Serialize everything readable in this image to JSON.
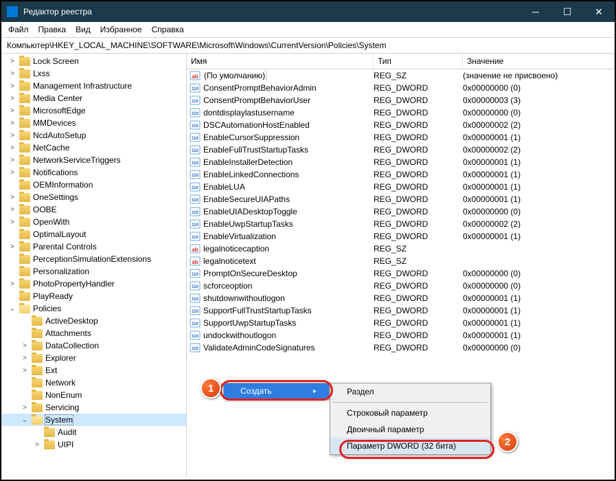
{
  "window": {
    "title": "Редактор реестра"
  },
  "menu": [
    "Файл",
    "Правка",
    "Вид",
    "Избранное",
    "Справка"
  ],
  "address": "Компьютер\\HKEY_LOCAL_MACHINE\\SOFTWARE\\Microsoft\\Windows\\CurrentVersion\\Policies\\System",
  "columns": {
    "name": "Имя",
    "type": "Тип",
    "value": "Значение"
  },
  "tree": [
    {
      "l": "Lock Screen",
      "d": 1,
      "e": ">"
    },
    {
      "l": "Lxss",
      "d": 1,
      "e": ">"
    },
    {
      "l": "Management Infrastructure",
      "d": 1,
      "e": ">"
    },
    {
      "l": "Media Center",
      "d": 1,
      "e": ">"
    },
    {
      "l": "MicrosoftEdge",
      "d": 1,
      "e": ">"
    },
    {
      "l": "MMDevices",
      "d": 1,
      "e": ">"
    },
    {
      "l": "NcdAutoSetup",
      "d": 1,
      "e": ">"
    },
    {
      "l": "NetCache",
      "d": 1,
      "e": ">"
    },
    {
      "l": "NetworkServiceTriggers",
      "d": 1,
      "e": ">"
    },
    {
      "l": "Notifications",
      "d": 1,
      "e": ">"
    },
    {
      "l": "OEMInformation",
      "d": 1,
      "e": ""
    },
    {
      "l": "OneSettings",
      "d": 1,
      "e": ">"
    },
    {
      "l": "OOBE",
      "d": 1,
      "e": ">"
    },
    {
      "l": "OpenWith",
      "d": 1,
      "e": ">"
    },
    {
      "l": "OptimalLayout",
      "d": 1,
      "e": ""
    },
    {
      "l": "Parental Controls",
      "d": 1,
      "e": ">"
    },
    {
      "l": "PerceptionSimulationExtensions",
      "d": 1,
      "e": ""
    },
    {
      "l": "Personalization",
      "d": 1,
      "e": ""
    },
    {
      "l": "PhotoPropertyHandler",
      "d": 1,
      "e": ">"
    },
    {
      "l": "PlayReady",
      "d": 1,
      "e": ""
    },
    {
      "l": "Policies",
      "d": 1,
      "e": "v",
      "open": true
    },
    {
      "l": "ActiveDesktop",
      "d": 2,
      "e": ""
    },
    {
      "l": "Attachments",
      "d": 2,
      "e": ""
    },
    {
      "l": "DataCollection",
      "d": 2,
      "e": ">"
    },
    {
      "l": "Explorer",
      "d": 2,
      "e": ">"
    },
    {
      "l": "Ext",
      "d": 2,
      "e": ">"
    },
    {
      "l": "Network",
      "d": 2,
      "e": ""
    },
    {
      "l": "NonEnum",
      "d": 2,
      "e": ""
    },
    {
      "l": "Servicing",
      "d": 2,
      "e": ">"
    },
    {
      "l": "System",
      "d": 2,
      "e": "v",
      "open": true,
      "sel": true
    },
    {
      "l": "Audit",
      "d": 3,
      "e": ""
    },
    {
      "l": "UIPI",
      "d": 3,
      "e": ">"
    }
  ],
  "values": [
    {
      "n": "(По умолчанию)",
      "t": "REG_SZ",
      "v": "(значение не присвоено)",
      "i": "str",
      "def": true
    },
    {
      "n": "ConsentPromptBehaviorAdmin",
      "t": "REG_DWORD",
      "v": "0x00000000 (0)",
      "i": "bin"
    },
    {
      "n": "ConsentPromptBehaviorUser",
      "t": "REG_DWORD",
      "v": "0x00000003 (3)",
      "i": "bin"
    },
    {
      "n": "dontdisplaylastusername",
      "t": "REG_DWORD",
      "v": "0x00000000 (0)",
      "i": "bin"
    },
    {
      "n": "DSCAutomationHostEnabled",
      "t": "REG_DWORD",
      "v": "0x00000002 (2)",
      "i": "bin"
    },
    {
      "n": "EnableCursorSuppression",
      "t": "REG_DWORD",
      "v": "0x00000001 (1)",
      "i": "bin"
    },
    {
      "n": "EnableFullTrustStartupTasks",
      "t": "REG_DWORD",
      "v": "0x00000002 (2)",
      "i": "bin"
    },
    {
      "n": "EnableInstallerDetection",
      "t": "REG_DWORD",
      "v": "0x00000001 (1)",
      "i": "bin"
    },
    {
      "n": "EnableLinkedConnections",
      "t": "REG_DWORD",
      "v": "0x00000001 (1)",
      "i": "bin"
    },
    {
      "n": "EnableLUA",
      "t": "REG_DWORD",
      "v": "0x00000001 (1)",
      "i": "bin"
    },
    {
      "n": "EnableSecureUIAPaths",
      "t": "REG_DWORD",
      "v": "0x00000001 (1)",
      "i": "bin"
    },
    {
      "n": "EnableUIADesktopToggle",
      "t": "REG_DWORD",
      "v": "0x00000000 (0)",
      "i": "bin"
    },
    {
      "n": "EnableUwpStartupTasks",
      "t": "REG_DWORD",
      "v": "0x00000002 (2)",
      "i": "bin"
    },
    {
      "n": "EnableVirtualization",
      "t": "REG_DWORD",
      "v": "0x00000001 (1)",
      "i": "bin"
    },
    {
      "n": "legalnoticecaption",
      "t": "REG_SZ",
      "v": "",
      "i": "str"
    },
    {
      "n": "legalnoticetext",
      "t": "REG_SZ",
      "v": "",
      "i": "str"
    },
    {
      "n": "PromptOnSecureDesktop",
      "t": "REG_DWORD",
      "v": "0x00000000 (0)",
      "i": "bin"
    },
    {
      "n": "scforceoption",
      "t": "REG_DWORD",
      "v": "0x00000000 (0)",
      "i": "bin"
    },
    {
      "n": "shutdownwithoutlogon",
      "t": "REG_DWORD",
      "v": "0x00000001 (1)",
      "i": "bin"
    },
    {
      "n": "SupportFullTrustStartupTasks",
      "t": "REG_DWORD",
      "v": "0x00000001 (1)",
      "i": "bin"
    },
    {
      "n": "SupportUwpStartupTasks",
      "t": "REG_DWORD",
      "v": "0x00000001 (1)",
      "i": "bin"
    },
    {
      "n": "undockwithoutlogon",
      "t": "REG_DWORD",
      "v": "0x00000001 (1)",
      "i": "bin"
    },
    {
      "n": "ValidateAdminCodeSignatures",
      "t": "REG_DWORD",
      "v": "0x00000000 (0)",
      "i": "bin"
    }
  ],
  "context1": {
    "create": "Создать"
  },
  "context2": {
    "section": "Раздел",
    "string": "Строковый параметр",
    "binary": "Двоичный параметр",
    "dword32": "Параметр DWORD (32 бита)"
  },
  "badges": {
    "b1": "1",
    "b2": "2"
  }
}
